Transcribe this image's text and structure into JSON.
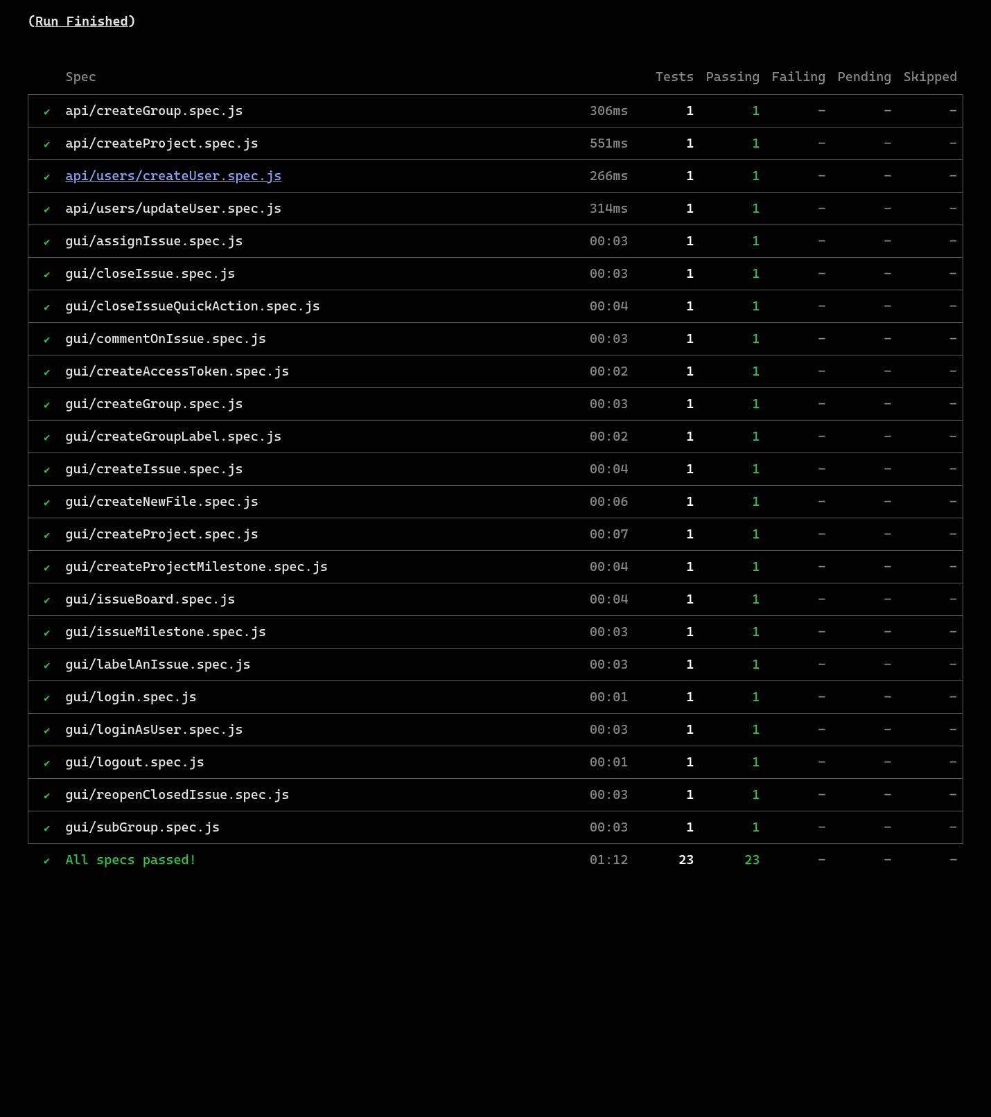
{
  "title": "Run Finished",
  "headers": {
    "spec": "Spec",
    "tests": "Tests",
    "passing": "Passing",
    "failing": "Failing",
    "pending": "Pending",
    "skipped": "Skipped"
  },
  "rows": [
    {
      "status": "pass",
      "spec": "api/createGroup.spec.js",
      "link": false,
      "dur": "306ms",
      "tests": "1",
      "passing": "1",
      "failing": "-",
      "pending": "-",
      "skipped": "-"
    },
    {
      "status": "pass",
      "spec": "api/createProject.spec.js",
      "link": false,
      "dur": "551ms",
      "tests": "1",
      "passing": "1",
      "failing": "-",
      "pending": "-",
      "skipped": "-"
    },
    {
      "status": "pass",
      "spec": "api/users/createUser.spec.js",
      "link": true,
      "dur": "266ms",
      "tests": "1",
      "passing": "1",
      "failing": "-",
      "pending": "-",
      "skipped": "-"
    },
    {
      "status": "pass",
      "spec": "api/users/updateUser.spec.js",
      "link": false,
      "dur": "314ms",
      "tests": "1",
      "passing": "1",
      "failing": "-",
      "pending": "-",
      "skipped": "-"
    },
    {
      "status": "pass",
      "spec": "gui/assignIssue.spec.js",
      "link": false,
      "dur": "00:03",
      "tests": "1",
      "passing": "1",
      "failing": "-",
      "pending": "-",
      "skipped": "-"
    },
    {
      "status": "pass",
      "spec": "gui/closeIssue.spec.js",
      "link": false,
      "dur": "00:03",
      "tests": "1",
      "passing": "1",
      "failing": "-",
      "pending": "-",
      "skipped": "-"
    },
    {
      "status": "pass",
      "spec": "gui/closeIssueQuickAction.spec.js",
      "link": false,
      "dur": "00:04",
      "tests": "1",
      "passing": "1",
      "failing": "-",
      "pending": "-",
      "skipped": "-"
    },
    {
      "status": "pass",
      "spec": "gui/commentOnIssue.spec.js",
      "link": false,
      "dur": "00:03",
      "tests": "1",
      "passing": "1",
      "failing": "-",
      "pending": "-",
      "skipped": "-"
    },
    {
      "status": "pass",
      "spec": "gui/createAccessToken.spec.js",
      "link": false,
      "dur": "00:02",
      "tests": "1",
      "passing": "1",
      "failing": "-",
      "pending": "-",
      "skipped": "-"
    },
    {
      "status": "pass",
      "spec": "gui/createGroup.spec.js",
      "link": false,
      "dur": "00:03",
      "tests": "1",
      "passing": "1",
      "failing": "-",
      "pending": "-",
      "skipped": "-"
    },
    {
      "status": "pass",
      "spec": "gui/createGroupLabel.spec.js",
      "link": false,
      "dur": "00:02",
      "tests": "1",
      "passing": "1",
      "failing": "-",
      "pending": "-",
      "skipped": "-"
    },
    {
      "status": "pass",
      "spec": "gui/createIssue.spec.js",
      "link": false,
      "dur": "00:04",
      "tests": "1",
      "passing": "1",
      "failing": "-",
      "pending": "-",
      "skipped": "-"
    },
    {
      "status": "pass",
      "spec": "gui/createNewFile.spec.js",
      "link": false,
      "dur": "00:06",
      "tests": "1",
      "passing": "1",
      "failing": "-",
      "pending": "-",
      "skipped": "-"
    },
    {
      "status": "pass",
      "spec": "gui/createProject.spec.js",
      "link": false,
      "dur": "00:07",
      "tests": "1",
      "passing": "1",
      "failing": "-",
      "pending": "-",
      "skipped": "-"
    },
    {
      "status": "pass",
      "spec": "gui/createProjectMilestone.spec.js",
      "link": false,
      "dur": "00:04",
      "tests": "1",
      "passing": "1",
      "failing": "-",
      "pending": "-",
      "skipped": "-"
    },
    {
      "status": "pass",
      "spec": "gui/issueBoard.spec.js",
      "link": false,
      "dur": "00:04",
      "tests": "1",
      "passing": "1",
      "failing": "-",
      "pending": "-",
      "skipped": "-"
    },
    {
      "status": "pass",
      "spec": "gui/issueMilestone.spec.js",
      "link": false,
      "dur": "00:03",
      "tests": "1",
      "passing": "1",
      "failing": "-",
      "pending": "-",
      "skipped": "-"
    },
    {
      "status": "pass",
      "spec": "gui/labelAnIssue.spec.js",
      "link": false,
      "dur": "00:03",
      "tests": "1",
      "passing": "1",
      "failing": "-",
      "pending": "-",
      "skipped": "-"
    },
    {
      "status": "pass",
      "spec": "gui/login.spec.js",
      "link": false,
      "dur": "00:01",
      "tests": "1",
      "passing": "1",
      "failing": "-",
      "pending": "-",
      "skipped": "-"
    },
    {
      "status": "pass",
      "spec": "gui/loginAsUser.spec.js",
      "link": false,
      "dur": "00:03",
      "tests": "1",
      "passing": "1",
      "failing": "-",
      "pending": "-",
      "skipped": "-"
    },
    {
      "status": "pass",
      "spec": "gui/logout.spec.js",
      "link": false,
      "dur": "00:01",
      "tests": "1",
      "passing": "1",
      "failing": "-",
      "pending": "-",
      "skipped": "-"
    },
    {
      "status": "pass",
      "spec": "gui/reopenClosedIssue.spec.js",
      "link": false,
      "dur": "00:03",
      "tests": "1",
      "passing": "1",
      "failing": "-",
      "pending": "-",
      "skipped": "-"
    },
    {
      "status": "pass",
      "spec": "gui/subGroup.spec.js",
      "link": false,
      "dur": "00:03",
      "tests": "1",
      "passing": "1",
      "failing": "-",
      "pending": "-",
      "skipped": "-"
    }
  ],
  "summary": {
    "label": "All specs passed!",
    "dur": "01:12",
    "tests": "23",
    "passing": "23",
    "failing": "-",
    "pending": "-",
    "skipped": "-"
  }
}
